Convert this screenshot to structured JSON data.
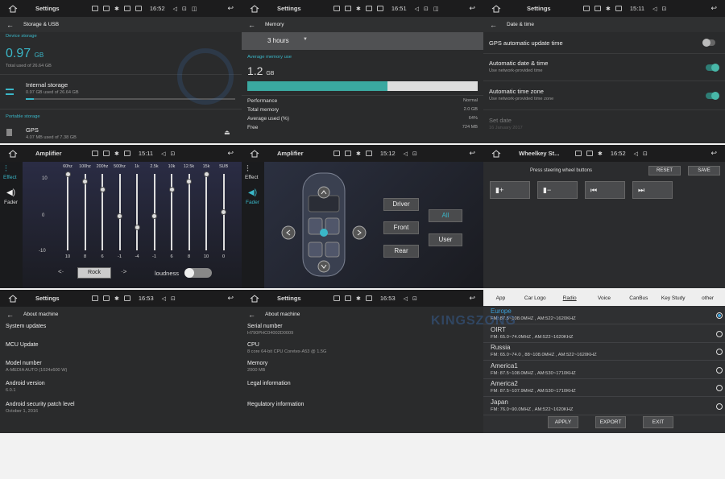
{
  "p1": {
    "status": {
      "title": "Settings",
      "time": "16:52"
    },
    "header": "Storage & USB",
    "device_storage": "Device storage",
    "used_value": "0.97",
    "used_unit": "GB",
    "used_total": "Total used of 26.64 GB",
    "internal_title": "Internal storage",
    "internal_sub": "0.97 GB used of 26.64 GB",
    "portable": "Portable storage",
    "gps_title": "GPS",
    "gps_sub": "4.07 MB used of 7.38 GB"
  },
  "p2": {
    "status": {
      "title": "Settings",
      "time": "16:51"
    },
    "header": "Memory",
    "period": "3 hours",
    "avg_label": "Average memory use",
    "avg_value": "1.2",
    "avg_unit": "GB",
    "usage_fraction": 0.61,
    "stats": [
      {
        "k": "Performance",
        "v": "Normal"
      },
      {
        "k": "Total memory",
        "v": "2.0 GB"
      },
      {
        "k": "Average used (%)",
        "v": "64%"
      },
      {
        "k": "Free",
        "v": "724 MB"
      }
    ]
  },
  "p3": {
    "status": {
      "title": "Settings",
      "time": "15:11"
    },
    "header": "Date & time",
    "gps_update": "GPS automatic update time",
    "auto_date": "Automatic date & time",
    "auto_date_sub": "Use network-provided time",
    "auto_zone": "Automatic time zone",
    "auto_zone_sub": "Use network-provided time zone",
    "set_date": "Set date",
    "set_date_sub": "16 January 2017"
  },
  "p4": {
    "status": {
      "title": "Amplifier",
      "time": "15:11"
    },
    "effect": "Effect",
    "fader": "Fader",
    "bands": [
      "60hz",
      "100hz",
      "200hz",
      "500hz",
      "1k",
      "2.5k",
      "10k",
      "12.5k",
      "15k",
      "SUB"
    ],
    "values": [
      "10",
      "8",
      "6",
      "-1",
      "-4",
      "-1",
      "6",
      "8",
      "10",
      "0"
    ],
    "scale": [
      "10",
      "0",
      "-10"
    ],
    "preset": "Rock",
    "loudness": "loudness",
    "arrow_left": "<·",
    "arrow_right": "·>"
  },
  "p5": {
    "status": {
      "title": "Amplifier",
      "time": "15:12"
    },
    "effect": "Effect",
    "fader": "Fader",
    "buttons": {
      "driver": "Driver",
      "front": "Front",
      "rear": "Rear",
      "all": "All",
      "user": "User"
    }
  },
  "p6": {
    "status": {
      "title": "Wheelkey St...",
      "time": "16:52"
    },
    "instruction": "Press steering wheel buttons",
    "reset": "RESET",
    "save": "SAVE"
  },
  "p7": {
    "status": {
      "title": "Settings",
      "time": "16:53"
    },
    "header": "About machine",
    "items": [
      {
        "t": "System updates",
        "s": ""
      },
      {
        "t": "MCU Update",
        "s": ""
      },
      {
        "t": "Model number",
        "s": "A-MEDIA AUTO (1024x600 W)"
      },
      {
        "t": "Android version",
        "s": "6.0.1"
      },
      {
        "t": "Android security patch level",
        "s": "October 1, 2016"
      }
    ]
  },
  "p8": {
    "status": {
      "title": "Settings",
      "time": "16:53"
    },
    "header": "About machine",
    "items": [
      {
        "t": "Serial number",
        "s": "H790PHC04002D0009"
      },
      {
        "t": "CPU",
        "s": "8 core 64-bit CPU Coretex-A53 @ 1.5G"
      },
      {
        "t": "Memory",
        "s": "2000 MB"
      },
      {
        "t": "Legal information",
        "s": ""
      },
      {
        "t": "Regulatory information",
        "s": ""
      }
    ]
  },
  "p9": {
    "tabs": [
      "App",
      "Car Logo",
      "Radio",
      "Voice",
      "CanBus",
      "Key Study",
      "other"
    ],
    "regions": [
      {
        "name": "Europe",
        "fm": "FM: 87.5~108.0MHZ , AM:522~1620KHZ"
      },
      {
        "name": "OIRT",
        "fm": "FM: 65.0~74.0MHZ , AM:522~1620KHZ"
      },
      {
        "name": "Russia",
        "fm": "FM: 65.0~74.0 , 88~108.0MHZ , AM:522~1620KHZ"
      },
      {
        "name": "America1",
        "fm": "FM: 87.5~108.0MHZ , AM:530~1710KHZ"
      },
      {
        "name": "America2",
        "fm": "FM: 87.5~107.9MHZ , AM:530~1710KHZ"
      },
      {
        "name": "Japan",
        "fm": "FM: 76.0~90.0MHZ , AM:522~1620KHZ"
      }
    ],
    "apply": "APPLY",
    "export": "EXPORT",
    "exit": "EXIT"
  },
  "watermark": "KINGSZONG",
  "colors": {
    "accent": "#3ab7c8",
    "toggle_on": "#48b7a8"
  }
}
